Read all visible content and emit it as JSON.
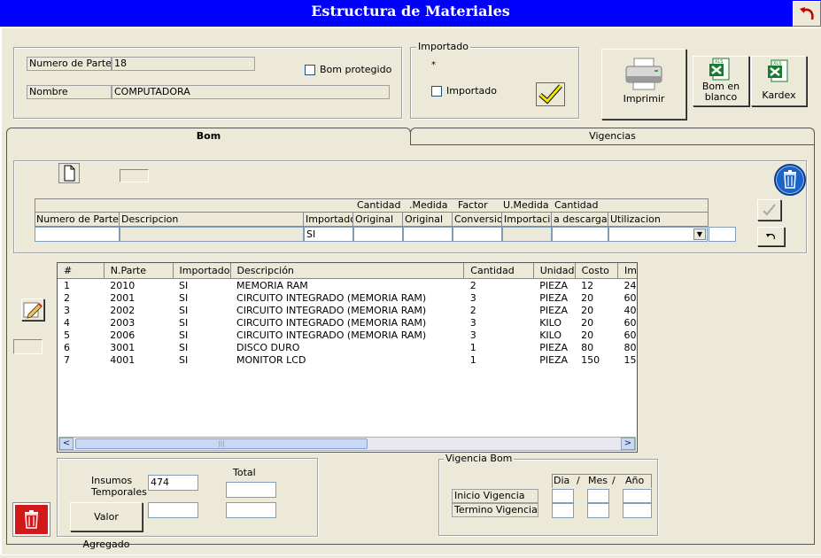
{
  "window": {
    "title": "Estructura de Materiales"
  },
  "header": {
    "numero_parte_label": "Numero de Parte",
    "numero_parte_value": "18",
    "nombre_label": "Nombre",
    "nombre_value": "COMPUTADORA",
    "bom_protegido_label": "Bom protegido",
    "importado_group_title": "Importado",
    "importado_marker": "*",
    "importado_label": "Importado"
  },
  "toolbar": {
    "imprimir_label": "Imprimir",
    "bom_en_blanco_label": "Bom en blanco",
    "kardex_label": "Kardex"
  },
  "tabs": [
    {
      "label": "Bom",
      "active": true
    },
    {
      "label": "Vigencias",
      "active": false
    }
  ],
  "entry_grid": {
    "headers_top": [
      "Cantidad",
      ".Medida",
      "Factor",
      "U.Medida",
      "Cantidad"
    ],
    "headers_bottom": [
      "Numero de Parte",
      "Descripcion",
      "Importado",
      "Original",
      "Original",
      "Conversion",
      "Importacion",
      "a descargar",
      "Utilizacion"
    ],
    "importado_value": "SI"
  },
  "list": {
    "columns": [
      "#",
      "N.Parte",
      "Importado",
      "Descripción",
      "Cantidad",
      "Unidad",
      "Costo",
      "Im"
    ],
    "rows": [
      [
        "1",
        "2010",
        "SI",
        "MEMORIA RAM",
        "2",
        "PIEZA",
        "12",
        "24"
      ],
      [
        "2",
        "2001",
        "SI",
        "CIRCUITO INTEGRADO (MEMORIA RAM)",
        "3",
        "PIEZA",
        "20",
        "60"
      ],
      [
        "3",
        "2002",
        "SI",
        "CIRCUITO INTEGRADO (MEMORIA RAM)",
        "2",
        "PIEZA",
        "20",
        "40"
      ],
      [
        "4",
        "2003",
        "SI",
        "CIRCUITO INTEGRADO (MEMORIA RAM)",
        "3",
        "KILO",
        "20",
        "60"
      ],
      [
        "5",
        "2006",
        "SI",
        "CIRCUITO INTEGRADO (MEMORIA RAM)",
        "3",
        "KILO",
        "20",
        "60"
      ],
      [
        "6",
        "3001",
        "SI",
        "DISCO DURO",
        "1",
        "PIEZA",
        "80",
        "80"
      ],
      [
        "7",
        "4001",
        "SI",
        "MONITOR LCD",
        "1",
        "PIEZA",
        "150",
        "15"
      ]
    ]
  },
  "totals": {
    "total_label": "Total",
    "insumos_label_1": "Insumos",
    "insumos_label_2": "Temporales",
    "insumos_value": "474",
    "valor_agregado_label": "Valor Agregado"
  },
  "vigencia": {
    "group_title": "Vigencia Bom",
    "dia_label": "Dia",
    "sep1": "/",
    "mes_label": "Mes",
    "sep2": "/",
    "anio_label": "Año",
    "inicio_label": "Inicio Vigencia",
    "termino_label": "Termino Vigencia"
  },
  "icons": {
    "undo": "undo-arrow-icon",
    "printer": "printer-icon",
    "excel": "excel-icon",
    "trash": "trash-icon",
    "checkmark": "checkmark-icon",
    "new_document": "new-document-icon",
    "edit": "edit-pencil-icon"
  },
  "colors": {
    "titlebar": "#0000ff",
    "form_bg": "#ece9d8",
    "trash_blue": "#1a63c8",
    "trash_red": "#d21818",
    "check_yellow": "#f2e600"
  }
}
